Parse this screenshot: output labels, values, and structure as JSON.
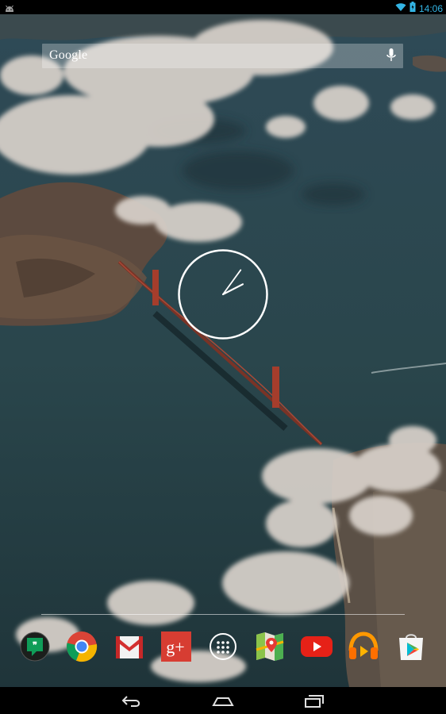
{
  "status_bar": {
    "time": "14:06",
    "icons": [
      "android-notification-icon",
      "wifi-icon",
      "battery-charging-icon"
    ]
  },
  "search_widget": {
    "label": "Google",
    "mic_icon": "microphone-icon"
  },
  "clock_widget": {
    "type": "analog",
    "hour": 14,
    "minute": 6
  },
  "dock": {
    "apps": [
      {
        "name": "Hangouts",
        "icon": "hangouts-icon",
        "color": "#0f9d58"
      },
      {
        "name": "Chrome",
        "icon": "chrome-icon",
        "color": "#db4437"
      },
      {
        "name": "Gmail",
        "icon": "gmail-icon",
        "color": "#d32f2f"
      },
      {
        "name": "Google+",
        "icon": "google-plus-icon",
        "color": "#d73d32"
      },
      {
        "name": "Apps",
        "icon": "all-apps-icon",
        "color": "#ffffff"
      },
      {
        "name": "Maps",
        "icon": "maps-icon",
        "color": "#4caf50"
      },
      {
        "name": "YouTube",
        "icon": "youtube-icon",
        "color": "#e62117"
      },
      {
        "name": "Play Music",
        "icon": "play-music-icon",
        "color": "#ff9800"
      },
      {
        "name": "Play Store",
        "icon": "play-store-icon",
        "color": "#ffffff"
      }
    ]
  },
  "navigation_bar": {
    "buttons": [
      "back-icon",
      "home-icon",
      "recents-icon"
    ]
  },
  "colors": {
    "status_accent": "#33b5e5",
    "water": "#2a474e",
    "bridge": "#9a3a2c"
  }
}
